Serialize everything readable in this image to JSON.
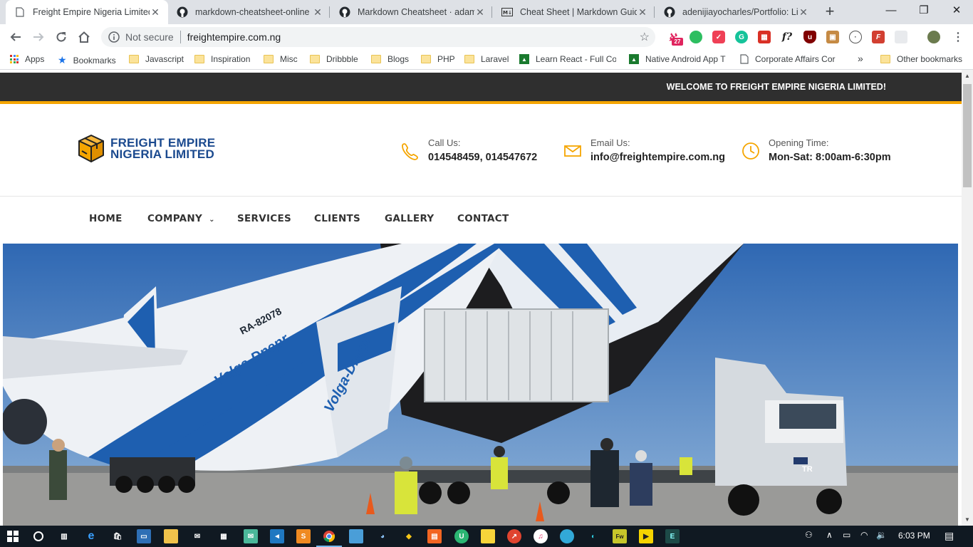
{
  "browser": {
    "tabs": [
      {
        "title": "Freight Empire Nigeria Limited",
        "favicon": "page-icon",
        "active": true
      },
      {
        "title": "markdown-cheatsheet-online",
        "favicon": "github-icon",
        "active": false
      },
      {
        "title": "Markdown Cheatsheet · adam-",
        "favicon": "github-icon",
        "active": false
      },
      {
        "title": "Cheat Sheet | Markdown Guide",
        "favicon": "markdown-icon",
        "active": false
      },
      {
        "title": "adenijiayocharles/Portfolio: Lis",
        "favicon": "github-icon",
        "active": false
      }
    ],
    "new_tab": "+",
    "address": {
      "security_label": "Not secure",
      "url": "freightempire.com.ng"
    },
    "extension_badge": "27",
    "bookmarks": [
      {
        "label": "Apps",
        "icon": "apps-grid-icon"
      },
      {
        "label": "Bookmarks",
        "icon": "star-icon"
      },
      {
        "label": "Javascript",
        "icon": "folder-icon"
      },
      {
        "label": "Inspiration",
        "icon": "folder-icon"
      },
      {
        "label": "Misc",
        "icon": "folder-icon"
      },
      {
        "label": "Dribbble",
        "icon": "folder-icon"
      },
      {
        "label": "Blogs",
        "icon": "folder-icon"
      },
      {
        "label": "PHP",
        "icon": "folder-icon"
      },
      {
        "label": "Laravel",
        "icon": "folder-icon"
      },
      {
        "label": "Learn React - Full Cou",
        "icon": "udemy-icon"
      },
      {
        "label": "Native Android App T",
        "icon": "udemy-icon"
      },
      {
        "label": "Corporate Affairs Cor",
        "icon": "page-icon"
      }
    ],
    "bookmarks_overflow": "»",
    "other_bookmarks": "Other bookmarks"
  },
  "site": {
    "welcome": "WELCOME TO FREIGHT EMPIRE NIGERIA LIMITED!",
    "logo": {
      "line1": "FREIGHT EMPIRE",
      "line2": "NIGERIA LIMITED"
    },
    "contact": {
      "call_label": "Call Us:",
      "call_value": "014548459, 014547672",
      "email_label": "Email Us:",
      "email_value": "info@freightempire.com.ng",
      "hours_label": "Opening Time:",
      "hours_value": "Mon-Sat: 8:00am-6:30pm"
    },
    "nav": [
      "HOME",
      "COMPANY",
      "SERVICES",
      "CLIENTS",
      "GALLERY",
      "CONTACT"
    ],
    "nav_dropdown_indicator": "⌄",
    "hero_alt": "Cargo aircraft being loaded",
    "hero_text": {
      "reg": "RA-82078",
      "airline": "Volga-Dnepr",
      "truck_plate": "TR"
    },
    "accent_color": "#f5a500",
    "brand_color": "#1b4a8f"
  },
  "taskbar": {
    "time": "6:03 PM"
  }
}
